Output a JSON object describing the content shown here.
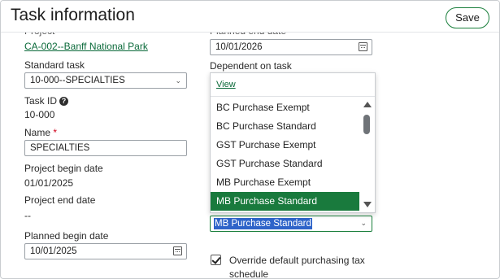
{
  "header": {
    "title": "Task information",
    "save_label": "Save"
  },
  "left": {
    "project_label": "Project",
    "project_link": "CA-002--Banff National Park",
    "standard_task_label": "Standard task",
    "standard_task_value": "10-000--SPECIALTIES",
    "task_id_label": "Task ID",
    "task_id_value": "10-000",
    "name_label": "Name",
    "name_required": "*",
    "name_value": "SPECIALTIES",
    "project_begin_label": "Project begin date",
    "project_begin_value": "01/01/2025",
    "project_end_label": "Project end date",
    "project_end_value": "--",
    "planned_begin_label": "Planned begin date",
    "planned_begin_value": "10/01/2025"
  },
  "right": {
    "planned_end_label": "Planned end date",
    "planned_end_value": "10/01/2026",
    "dependent_label": "Dependent on task",
    "purchasing_value": "MB Purchase Standard",
    "override_label": "Override default purchasing tax schedule",
    "override_checked": true
  },
  "dropdown": {
    "view_label": "View",
    "items": [
      {
        "label": "BC Purchase Exempt"
      },
      {
        "label": "BC Purchase Standard"
      },
      {
        "label": "GST Purchase Exempt"
      },
      {
        "label": "GST Purchase Standard"
      },
      {
        "label": "MB Purchase Exempt"
      },
      {
        "label": "MB Purchase Standard"
      }
    ],
    "selected": "MB Purchase Standard"
  },
  "icons": {
    "info": "info-icon",
    "calendar": "calendar-icon",
    "chevron": "chevron-down-icon",
    "check": "checkmark-icon"
  },
  "colors": {
    "accent": "#197a3d",
    "required": "#d0021b",
    "link": "#0b6a3a",
    "text_selection": "#2f64c9"
  }
}
